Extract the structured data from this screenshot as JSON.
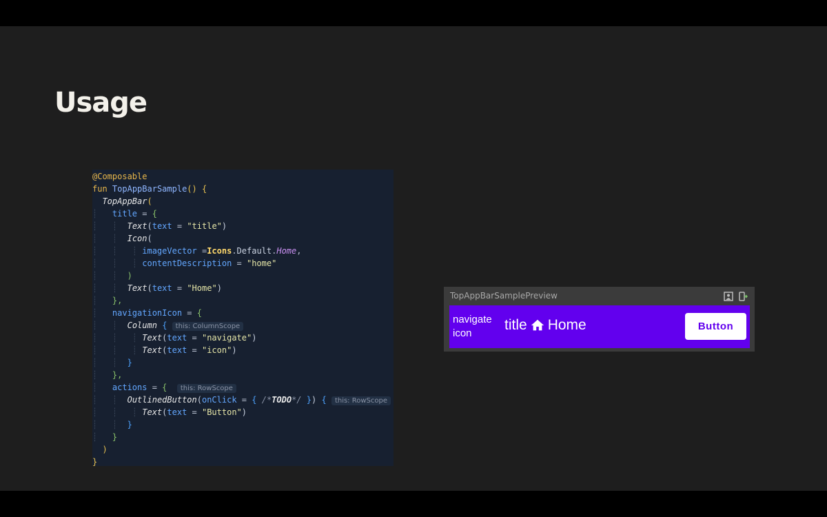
{
  "slide": {
    "title": "Usage"
  },
  "code": {
    "l1": "@Composable",
    "l2_kw": "fun",
    "l2_name": "TopAppBarSample",
    "l3": "TopAppBar",
    "l4_param": "title",
    "l5_fn": "Text",
    "l5_param": "text",
    "l5_str": "\"title\"",
    "l6_fn": "Icon",
    "l7_param": "imageVector",
    "l7_cls": "Icons",
    "l7_default": "Default",
    "l7_home": "Home",
    "l8_param": "contentDescription",
    "l8_str": "\"home\"",
    "l10_fn": "Text",
    "l10_param": "text",
    "l10_str": "\"Home\"",
    "l12_param": "navigationIcon",
    "l13_fn": "Column",
    "l13_hint": "this: ColumnScope",
    "l14_fn": "Text",
    "l14_param": "text",
    "l14_str": "\"navigate\"",
    "l15_fn": "Text",
    "l15_param": "text",
    "l15_str": "\"icon\"",
    "l18_param": "actions",
    "l18_hint": "this: RowScope",
    "l19_fn": "OutlinedButton",
    "l19_param": "onClick",
    "l19_todo": "TODO",
    "l19_hint": "this: RowScope",
    "l20_fn": "Text",
    "l20_param": "text",
    "l20_str": "\"Button\""
  },
  "preview": {
    "title": "TopAppBarSamplePreview",
    "nav_line1": "navigate",
    "nav_line2": "icon",
    "appbar_title": "title",
    "appbar_home": "Home",
    "button_label": "Button",
    "appbar_color": "#6200ee"
  }
}
